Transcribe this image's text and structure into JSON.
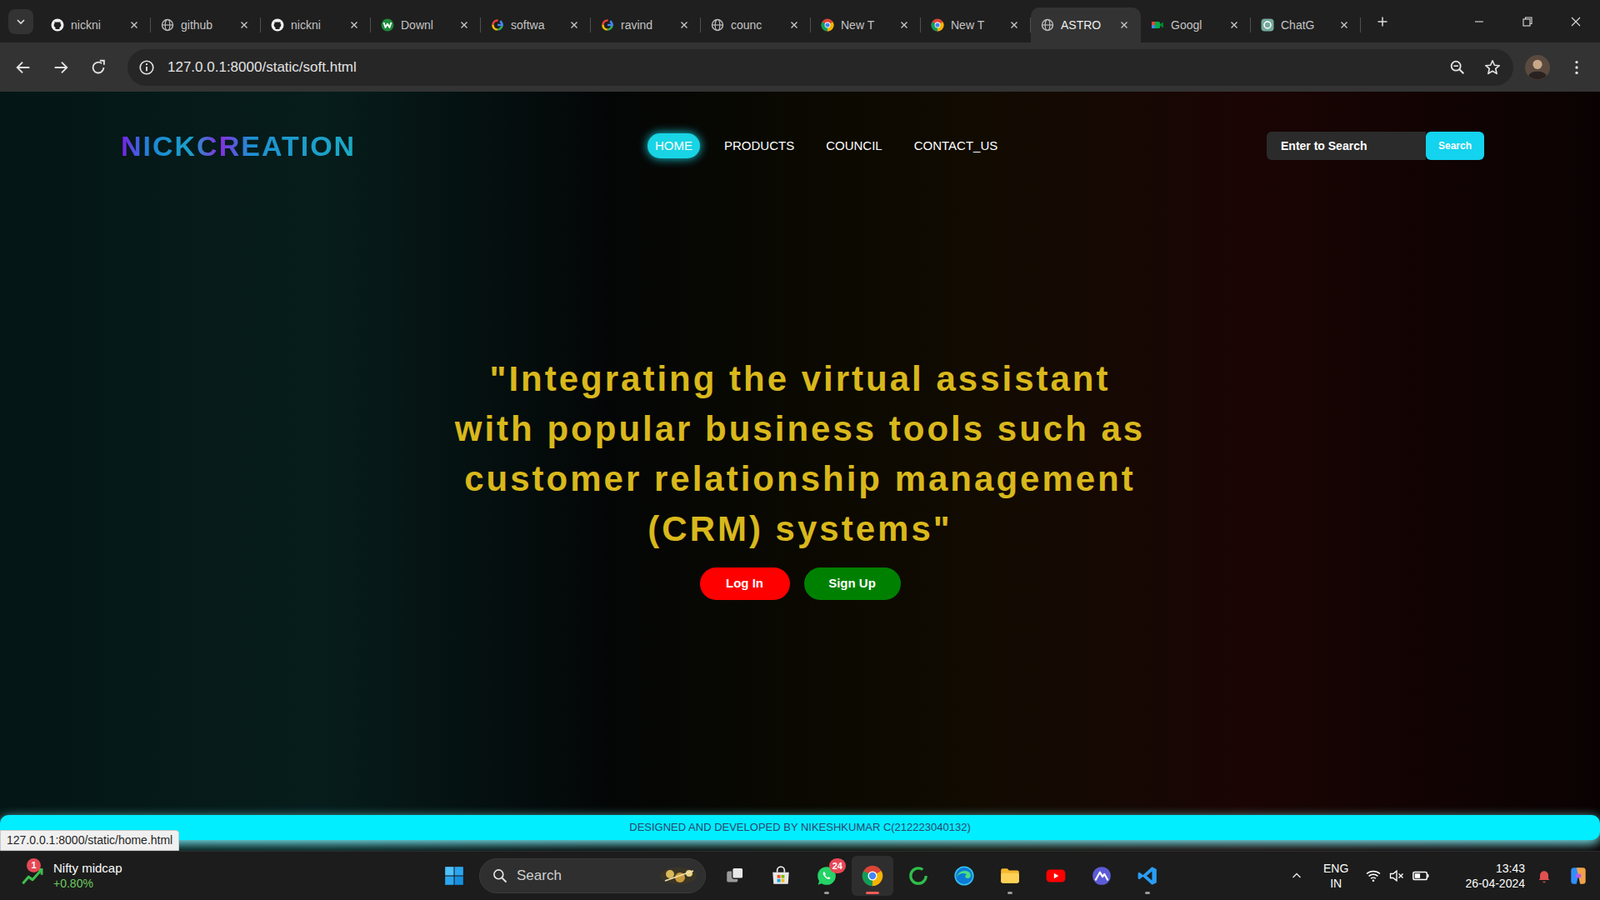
{
  "browser": {
    "tabs": [
      {
        "label": "nickni",
        "kind": "github",
        "selected": false
      },
      {
        "label": "github",
        "kind": "globe",
        "selected": false
      },
      {
        "label": "nickni",
        "kind": "github",
        "selected": false
      },
      {
        "label": "Downl",
        "kind": "wattpad",
        "selected": false
      },
      {
        "label": "softwa",
        "kind": "google",
        "selected": false
      },
      {
        "label": "ravind",
        "kind": "google",
        "selected": false
      },
      {
        "label": "counc",
        "kind": "globe",
        "selected": false
      },
      {
        "label": "New T",
        "kind": "chrome",
        "selected": false
      },
      {
        "label": "New T",
        "kind": "chrome",
        "selected": false
      },
      {
        "label": "ASTRO",
        "kind": "globe",
        "selected": true
      },
      {
        "label": "Googl",
        "kind": "meet",
        "selected": false
      },
      {
        "label": "ChatG",
        "kind": "chatgpt",
        "selected": false
      }
    ],
    "address": "127.0.0.1:8000/static/soft.html",
    "status_url": "127.0.0.1:8000/static/home.html"
  },
  "page": {
    "logo": "NICKCREATION",
    "nav": [
      {
        "label": "HOME",
        "selected": true
      },
      {
        "label": "PRODUCTS",
        "selected": false
      },
      {
        "label": "COUNCIL",
        "selected": false
      },
      {
        "label": "CONTACT_US",
        "selected": false
      }
    ],
    "search": {
      "placeholder": "Enter to Search",
      "button": "Search"
    },
    "headline": [
      "\"Integrating the virtual assistant",
      "with popular business tools such as",
      "customer relationship management",
      "(CRM) systems\""
    ],
    "buttons": [
      {
        "label": "Log In",
        "color": "#ff0000"
      },
      {
        "label": "Sign Up",
        "color": "#008000"
      }
    ],
    "footer": "DESIGNED AND DEVELOPED BY NIKESHKUMAR C(212223040132)"
  },
  "taskbar": {
    "widget": {
      "title": "Nifty midcap",
      "change": "+0.80%",
      "badge": "1"
    },
    "search": "Search",
    "apps": [
      {
        "kind": "taskview",
        "running": false,
        "selected": false
      },
      {
        "kind": "store",
        "running": false,
        "selected": false
      },
      {
        "kind": "whatsapp",
        "running": true,
        "selected": false,
        "badge": "24"
      },
      {
        "kind": "chrome",
        "running": true,
        "selected": true
      },
      {
        "kind": "ring",
        "running": false,
        "selected": false
      },
      {
        "kind": "edge",
        "running": false,
        "selected": false
      },
      {
        "kind": "explorer",
        "running": true,
        "selected": false
      },
      {
        "kind": "youtube",
        "running": false,
        "selected": false
      },
      {
        "kind": "launcher",
        "running": false,
        "selected": false
      },
      {
        "kind": "vscode",
        "running": true,
        "selected": false
      }
    ],
    "tray": {
      "lang": "ENG",
      "region": "IN",
      "time": "13:43",
      "date": "26-04-2024"
    }
  }
}
